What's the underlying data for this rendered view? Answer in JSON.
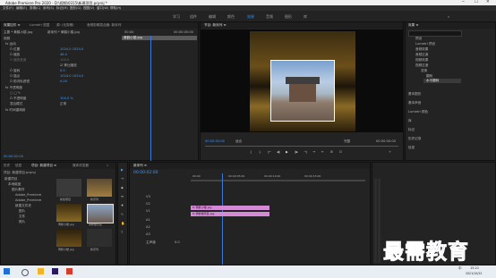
{
  "title_bar": {
    "text": "Adobe Premiere Pro 2020 - D:\\视频\\0315\\新建项目.prproj *",
    "minimize": "─",
    "maximize": "☐",
    "close": "✕"
  },
  "menu": [
    "文件(F)",
    "编辑(E)",
    "剪辑(C)",
    "序列(S)",
    "标记(M)",
    "图形(G)",
    "视图(V)",
    "窗口(W)",
    "帮助(H)"
  ],
  "workspaces": [
    "学习",
    "组件",
    "编辑",
    "颜色",
    "效果",
    "音频",
    "图形",
    "库"
  ],
  "active_workspace": "效果",
  "effect_controls": {
    "tabs": [
      "效果控件 ≡",
      "Lumetri 范围",
      "源: (无剪辑)",
      "音频剪辑混合器: 新序列"
    ],
    "source_label": "主要 * 黄鹤小楼.jpg",
    "sequence_label": "新序列 * 黄鹤小楼.jpg",
    "clip_chip": "黄鹤小楼.jpg",
    "time_left": "00:00",
    "time_right": "00:00:05:00",
    "section_video": "视频",
    "rows": [
      {
        "label": "fx 运动",
        "value": ""
      },
      {
        "label": "Ö 位置",
        "value": "1024.0   1024.0"
      },
      {
        "label": "Ö 缩放",
        "value": "46.0"
      },
      {
        "label": "Ö 缩放宽度",
        "value": "100.0"
      },
      {
        "label": "",
        "value": "☑ 等比缩放"
      },
      {
        "label": "Ö 旋转",
        "value": "0.0"
      },
      {
        "label": "Ö 锚点",
        "value": "1024.0   1024.0"
      },
      {
        "label": "Ö 防闪烁滤镜",
        "value": "0.00"
      },
      {
        "label": "fx 不透明度",
        "value": ""
      },
      {
        "label": "○ □ ✎",
        "value": ""
      },
      {
        "label": "Ö 不透明度",
        "value": "100.0 %"
      },
      {
        "label": "混合模式",
        "value": "正常"
      },
      {
        "label": "fx 时间重映射",
        "value": ""
      }
    ],
    "footer_time": "00:00:02:00"
  },
  "program_monitor": {
    "tab": "节目: 新序列 ≡",
    "timecode_left": "00:00:02:00",
    "fit": "适合",
    "quality": "完整",
    "timecode_right": "00:00:05:00",
    "controls": [
      "{",
      "}",
      "|←",
      "◀|",
      "▶",
      "|▶",
      "→|",
      "⇥",
      "⇤",
      "⊞",
      "⊡",
      "+"
    ]
  },
  "effects_panel": {
    "tab": "效果 ≡",
    "search": "",
    "tree": [
      {
        "label": "预设",
        "level": 0
      },
      {
        "label": "Lumetri 预设",
        "level": 0
      },
      {
        "label": "音频效果",
        "level": 0
      },
      {
        "label": "音频过渡",
        "level": 0
      },
      {
        "label": "视频效果",
        "level": 0
      },
      {
        "label": "视频过渡",
        "level": 0
      },
      {
        "label": "变换",
        "level": 1
      },
      {
        "label": "翻转",
        "level": 2
      },
      {
        "label": "水平翻转",
        "level": 2
      }
    ],
    "sections": [
      "基本图形",
      "基本声音",
      "Lumetri 颜色",
      "库",
      "标记",
      "历史记录",
      "信息"
    ]
  },
  "project_panel": {
    "tabs": [
      "历史",
      "信息",
      "项目: 新建项目 ≡",
      "媒体浏览器",
      "»"
    ],
    "path": "项目: 新建项目.prproj",
    "folder_items": [
      "新建项目",
      "本地磁盘",
      "图片素材",
      "Adobe_Premiere",
      "Adobe_Premiere",
      "新建文件夹",
      "图片",
      "文件",
      "照片"
    ],
    "thumbnails": [
      {
        "label": "新建项目",
        "duration": ""
      },
      {
        "label": "新序列",
        "duration": ""
      },
      {
        "label": "黄鹤小楼.jpg",
        "duration": ""
      },
      {
        "label": "黄鹤楼景区",
        "duration": ""
      },
      {
        "label": "黄鹤小楼.jpg",
        "duration": ""
      },
      {
        "label": "新序列",
        "duration": ""
      }
    ]
  },
  "timeline": {
    "tab": "新序列 ≡",
    "timecode": "00:00:02:00",
    "ruler_marks": [
      "00:00",
      "00:00:05:00",
      "00:00:10:00",
      "00:00:15:00"
    ],
    "tracks": [
      "V3",
      "V2",
      "V1",
      "A1",
      "A2",
      "A3",
      "主声道"
    ],
    "clips": [
      {
        "track": "V2",
        "label": "fx 黄鹤小楼.jpg"
      },
      {
        "track": "V1",
        "label": "fx 黄鹤楼景区.jpg"
      }
    ],
    "master_value": "0.0"
  },
  "tools": [
    "▶",
    "⇥",
    "◆",
    "⇹",
    "✚",
    "✎",
    "✋",
    "T"
  ],
  "watermark": "最需教育",
  "taskbar": {
    "time": "15:21",
    "date": "2021/10/22",
    "lang": "中"
  }
}
